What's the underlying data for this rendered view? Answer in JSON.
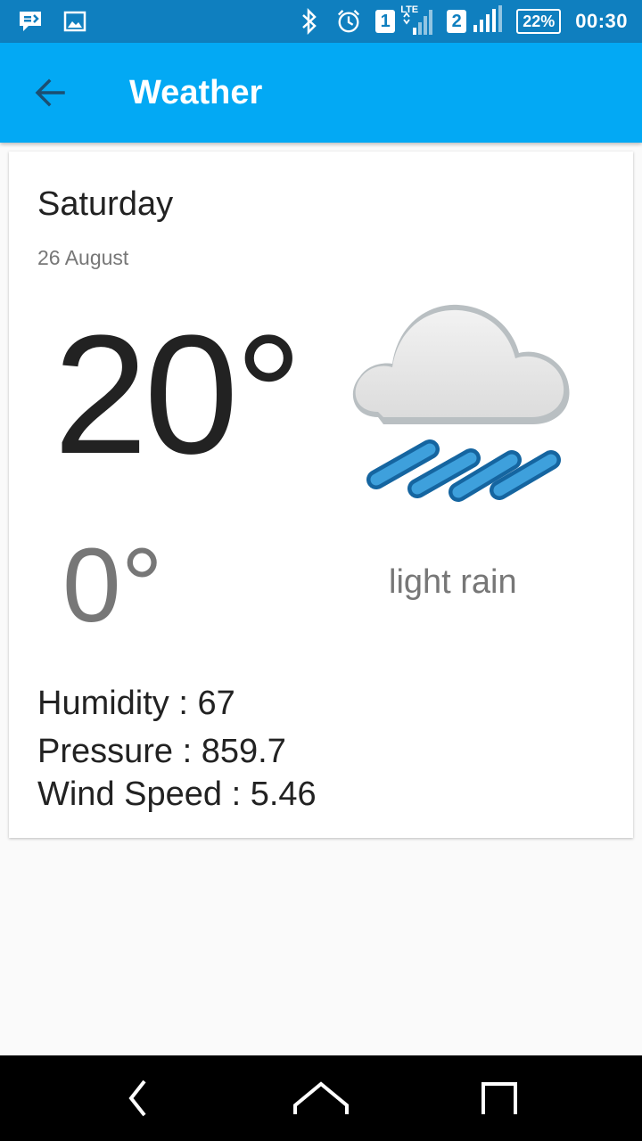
{
  "status_bar": {
    "left_icons": [
      "message-icon",
      "image-icon"
    ],
    "right_icons": [
      "bluetooth-icon",
      "alarm-icon",
      "sim1-signal-icon",
      "sim2-signal-icon"
    ],
    "network_type": "LTE",
    "sim1_label": "1",
    "sim2_label": "2",
    "battery": "22%",
    "time": "00:30"
  },
  "app_bar": {
    "title": "Weather",
    "back_icon": "arrow-back-icon",
    "color": "#03a9f4"
  },
  "forecast": {
    "day": "Saturday",
    "date": "26 August",
    "temp_high": "20°",
    "temp_low": "0°",
    "condition_icon": "light-rain-icon",
    "description": "light rain",
    "humidity": "Humidity : 67",
    "pressure": "Pressure : 859.7",
    "wind_speed": "Wind Speed : 5.46"
  },
  "nav_bar": {
    "icons": [
      "back-nav-icon",
      "home-nav-icon",
      "recents-nav-icon"
    ]
  }
}
